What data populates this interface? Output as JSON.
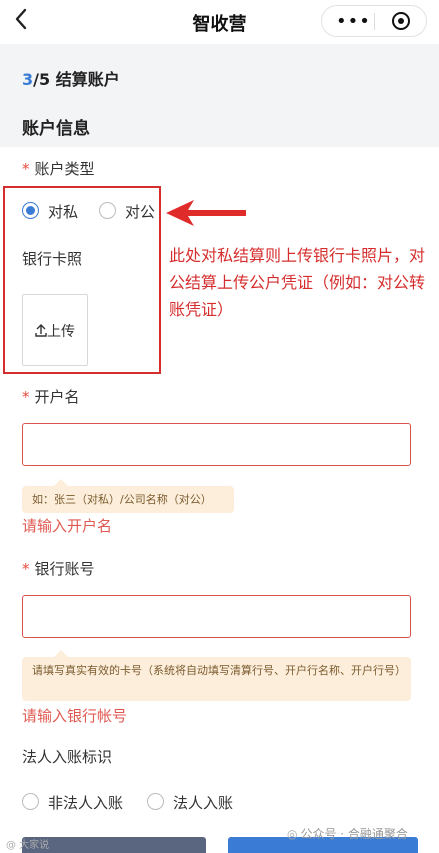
{
  "nav": {
    "back_glyph": "<",
    "title": "智收营",
    "menu_glyph": "•••"
  },
  "steps": {
    "current": "3",
    "rest": "/5 结算账户"
  },
  "section_title": "账户信息",
  "account_type": {
    "label": "账户类型",
    "options": [
      {
        "label": "对私",
        "selected": true
      },
      {
        "label": "对公",
        "selected": false
      }
    ]
  },
  "bank_card": {
    "label": "银行卡照",
    "upload_label": "上传",
    "upload_icon": "upload-icon"
  },
  "annotation": "此处对私结算则上传银行卡照片，对公结算上传公户凭证（例如：对公转账凭证）",
  "account_name": {
    "label": "开户名",
    "value": "",
    "tip": "如：张三（对私）/公司名称（对公）",
    "error": "请输入开户名"
  },
  "bank_account": {
    "label": "银行账号",
    "value": "",
    "tip": "请填写真实有效的卡号（系统将自动填写清算行号、开户行名称、开户行号）",
    "error": "请输入银行帐号"
  },
  "legal_person": {
    "label": "法人入账标识",
    "options": [
      {
        "label": "非法人入账",
        "selected": false
      },
      {
        "label": "法人入账",
        "selected": false
      }
    ]
  },
  "watermarks": {
    "left": "@ 大家说",
    "right": "公众号 · 合融通聚合"
  },
  "colors": {
    "accent": "#3a7bd5",
    "annotation_red": "#d62e2e",
    "error_red": "#e05a52",
    "tip_bg": "#fdeedb"
  }
}
